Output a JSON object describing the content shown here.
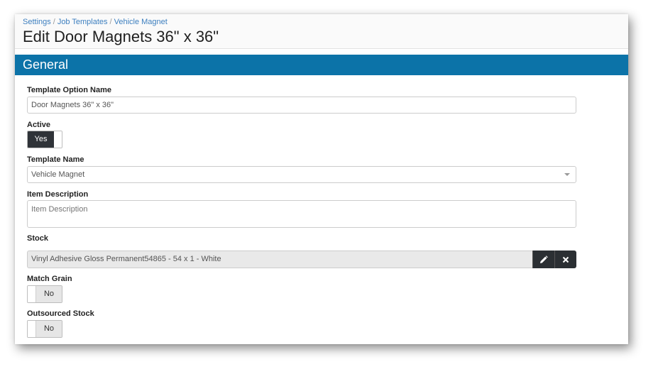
{
  "breadcrumb": [
    "Settings",
    "Job Templates",
    "Vehicle Magnet"
  ],
  "page_title": "Edit Door Magnets 36\" x 36\"",
  "section": {
    "title": "General"
  },
  "fields": {
    "template_option_name": {
      "label": "Template Option Name",
      "value": "Door Magnets 36\" x 36\""
    },
    "active": {
      "label": "Active",
      "value": "Yes"
    },
    "template_name": {
      "label": "Template Name",
      "value": "Vehicle Magnet"
    },
    "item_description": {
      "label": "Item Description",
      "placeholder": "Item Description"
    },
    "stock": {
      "label": "Stock",
      "value": "Vinyl Adhesive Gloss Permanent54865 - 54 x 1 - White"
    },
    "match_grain": {
      "label": "Match Grain",
      "value": "No"
    },
    "outsourced_stock": {
      "label": "Outsourced Stock",
      "value": "No"
    }
  },
  "icons": {
    "edit": "pencil-icon",
    "clear": "close-icon"
  },
  "colors": {
    "section_bar": "#0c73a8",
    "link": "#3d7fbf",
    "toggle_on": "#2f3338"
  }
}
